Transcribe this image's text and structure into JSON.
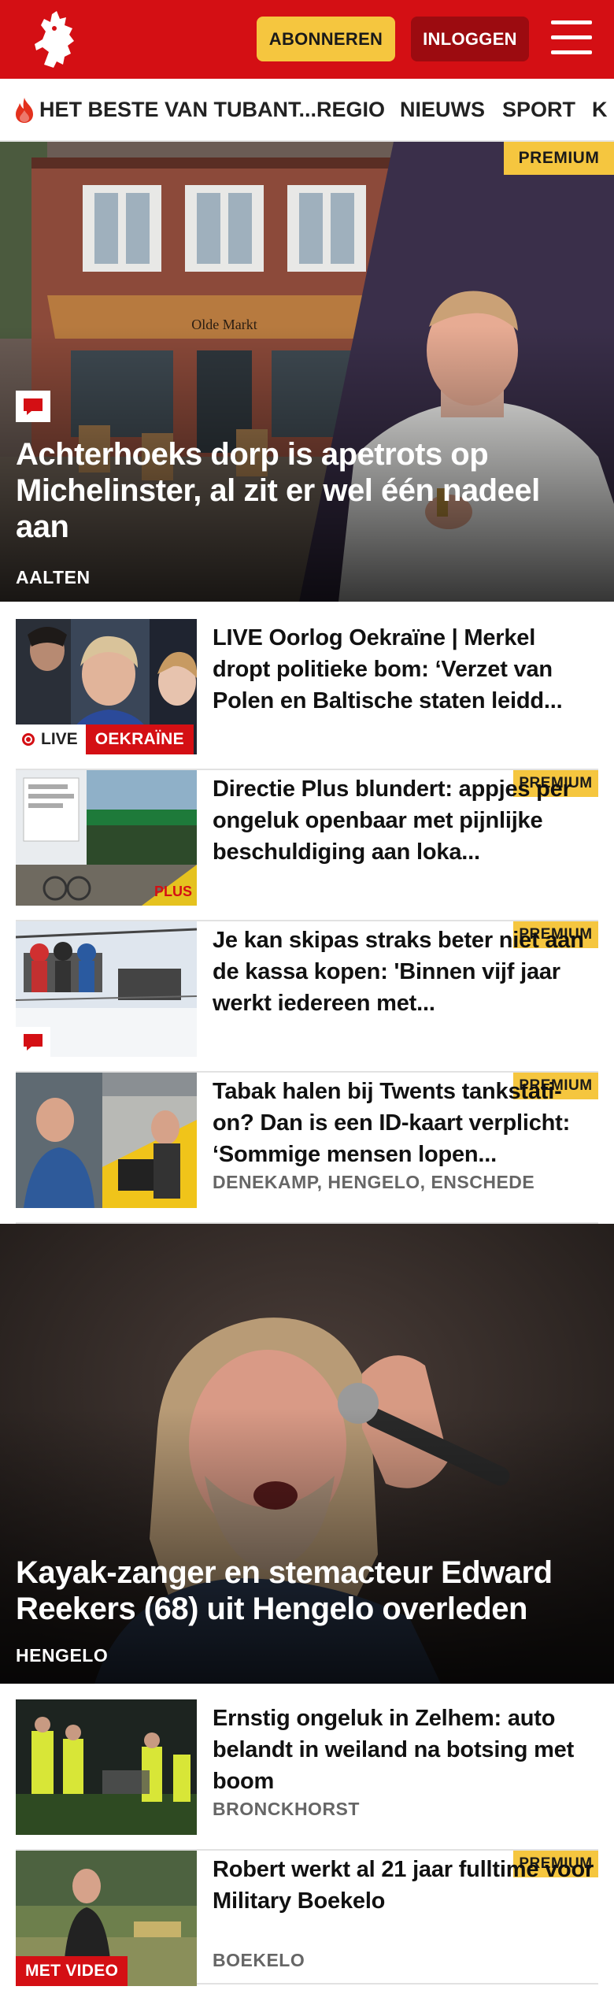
{
  "header": {
    "subscribe_label": "ABONNEREN",
    "login_label": "INLOGGEN",
    "brand_color": "#d40f14",
    "logo_icon": "twente-horse-icon",
    "menu_icon": "hamburger-menu-icon"
  },
  "nav": {
    "items": [
      {
        "label": "HET BESTE VAN TUBANT...",
        "icon": "flame-icon"
      },
      {
        "label": "REGIO"
      },
      {
        "label": "NIEUWS"
      },
      {
        "label": "SPORT"
      },
      {
        "label": "K"
      }
    ]
  },
  "articles": {
    "hero1": {
      "title": "Achterhoeks dorp is apetrots op Michelinster, al zit er wel één nadeel aan",
      "location": "AALTEN",
      "badge": "PREMIUM",
      "storefront_sign": "Olde Markt"
    },
    "row1": {
      "title": "LIVE Oorlog Oekraïne | Merkel dropt politieke bom: ‘Verzet van Polen en Baltische staten leidd...",
      "live_label": "LIVE",
      "topic_label": "OEKRAÏNE"
    },
    "row2": {
      "title": "Directie Plus blundert: appjes per ongeluk openbaar met pijnlijke beschuldiging aan loka...",
      "badge": "PREMIUM",
      "store_sign": "PLUS"
    },
    "row3": {
      "title": "Je kan skipas straks beter niet aan de kassa kopen: 'Binnen vijf jaar werkt iedereen met...",
      "badge": "PREMIUM"
    },
    "row4": {
      "title": "Tabak halen bij Twents tankstati-on? Dan is een ID-kaart verplicht: ‘Sommige mensen lopen...",
      "badge": "PREMIUM",
      "location": "DENEKAMP, HENGELO, ENSCHEDE"
    },
    "hero2": {
      "title": "Kayak-zanger en stemacteur Edward Reekers (68) uit Hengelo overleden",
      "location": "HENGELO"
    },
    "row5": {
      "title": "Ernstig ongeluk in Zelhem: auto belandt in weiland na botsing met boom",
      "location": "BRONCKHORST"
    },
    "row6": {
      "title": "Robert werkt al 21 jaar fulltime voor Military Boekelo",
      "badge": "PREMIUM",
      "video_label": "MET VIDEO",
      "location": "BOEKELO"
    }
  }
}
